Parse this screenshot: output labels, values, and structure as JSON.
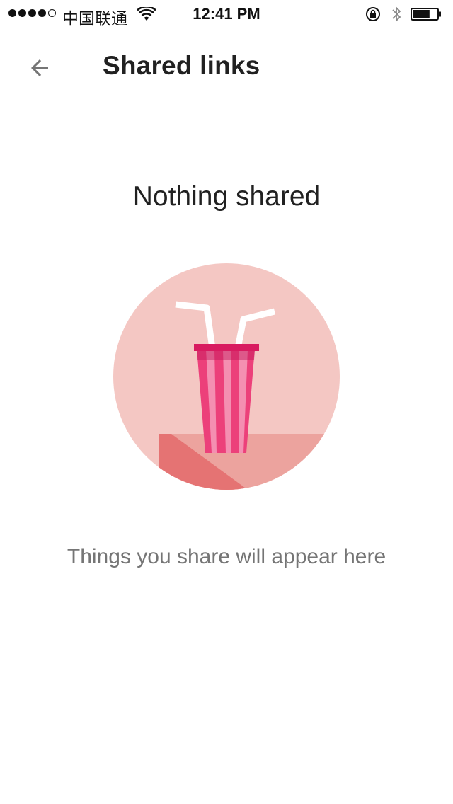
{
  "status_bar": {
    "carrier": "中国联通",
    "time": "12:41 PM",
    "signal_bars_filled": 4,
    "signal_bars_total": 5,
    "battery_level": 0.7
  },
  "app_bar": {
    "back_icon": "arrow-left-icon",
    "title": "Shared links"
  },
  "empty_state": {
    "heading": "Nothing shared",
    "illustration_icon": "soda-cup-illustration",
    "subtext": "Things you share will appear here"
  },
  "colors": {
    "circle_bg": "#f4c7c3",
    "cup_pink": "#ec407a",
    "cup_stripe": "#f48fb1",
    "table_top": "#eca39e",
    "table_side": "#e57373",
    "subtext": "#757575"
  }
}
